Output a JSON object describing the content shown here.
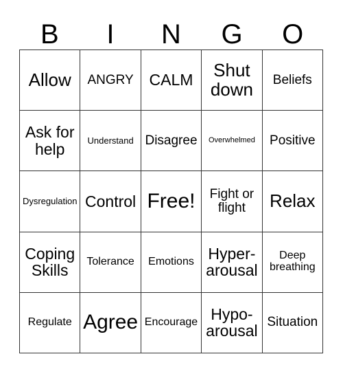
{
  "card": {
    "header_letters": [
      "B",
      "I",
      "N",
      "G",
      "O"
    ],
    "columns": 5,
    "rows": 5,
    "border_color": "#333333",
    "background_color": "#ffffff",
    "text_color": "#000000",
    "cells": [
      {
        "text": "Allow",
        "size": "xl"
      },
      {
        "text": "ANGRY",
        "size": "md"
      },
      {
        "text": "CALM",
        "size": "lg"
      },
      {
        "text": "Shut down",
        "size": "xl"
      },
      {
        "text": "Beliefs",
        "size": "md"
      },
      {
        "text": "Ask for help",
        "size": "lg"
      },
      {
        "text": "Understand",
        "size": "xs"
      },
      {
        "text": "Disagree",
        "size": "md"
      },
      {
        "text": "Overwhelmed",
        "size": "xxs"
      },
      {
        "text": "Positive",
        "size": "md"
      },
      {
        "text": "Dysregulation",
        "size": "xs"
      },
      {
        "text": "Control",
        "size": "lg"
      },
      {
        "text": "Free!",
        "size": "xxl"
      },
      {
        "text": "Fight or flight",
        "size": "md"
      },
      {
        "text": "Relax",
        "size": "xl"
      },
      {
        "text": "Coping Skills",
        "size": "lg"
      },
      {
        "text": "Tolerance",
        "size": "sm"
      },
      {
        "text": "Emotions",
        "size": "sm"
      },
      {
        "text": "Hyper-arousal",
        "size": "lg"
      },
      {
        "text": "Deep breathing",
        "size": "sm"
      },
      {
        "text": "Regulate",
        "size": "sm"
      },
      {
        "text": "Agree",
        "size": "xxl"
      },
      {
        "text": "Encourage",
        "size": "sm"
      },
      {
        "text": "Hypo-arousal",
        "size": "lg"
      },
      {
        "text": "Situation",
        "size": "md"
      }
    ]
  }
}
